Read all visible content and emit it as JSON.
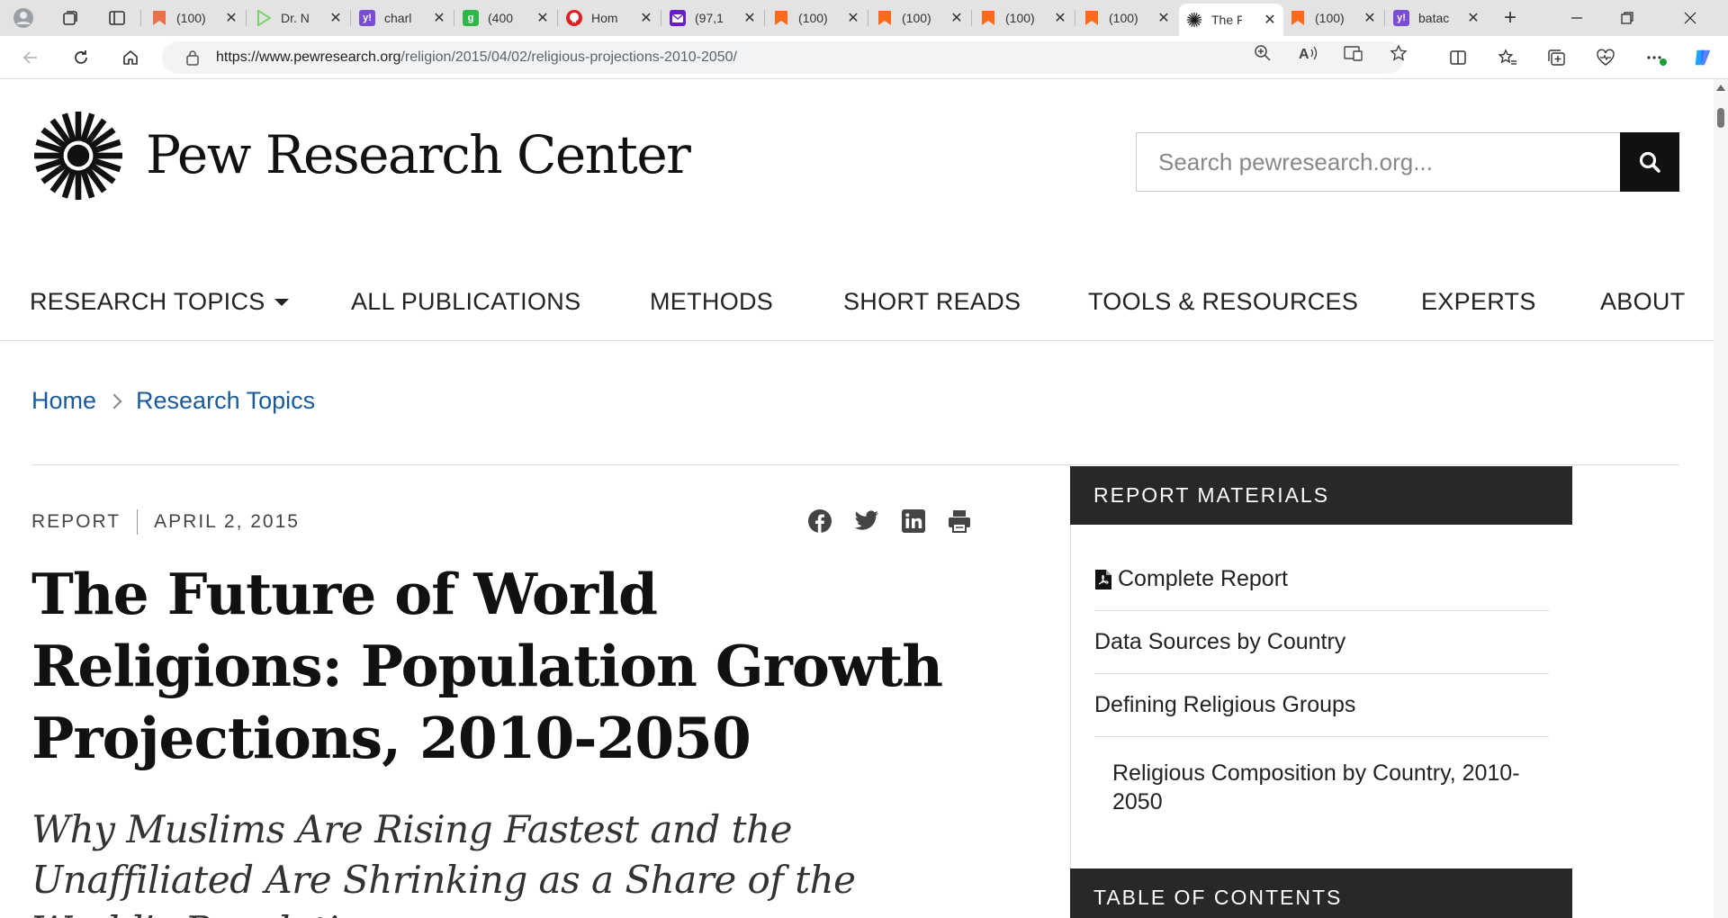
{
  "browser": {
    "tabs": [
      {
        "title": "(100)",
        "favicon_color": "#e8734a",
        "favicon_glyph": "bookmark-icon"
      },
      {
        "title": "Dr. N",
        "favicon_color": "#7bd36b",
        "favicon_glyph": "play-icon"
      },
      {
        "title": "charl",
        "favicon_color": "#7b4dd6",
        "favicon_glyph": "y!"
      },
      {
        "title": "(400",
        "favicon_color": "#2fb84a",
        "favicon_glyph": "g"
      },
      {
        "title": "Hom",
        "favicon_color": "#e02020",
        "favicon_glyph": "pin-icon"
      },
      {
        "title": "(97,1",
        "favicon_color": "#6a1bd1",
        "favicon_glyph": "mail-icon"
      },
      {
        "title": "(100)",
        "favicon_color": "#ff6a1a",
        "favicon_glyph": "bookmark-icon"
      },
      {
        "title": "(100)",
        "favicon_color": "#ff6a1a",
        "favicon_glyph": "bookmark-icon"
      },
      {
        "title": "(100)",
        "favicon_color": "#ff6a1a",
        "favicon_glyph": "bookmark-icon"
      },
      {
        "title": "(100)",
        "favicon_color": "#ff6a1a",
        "favicon_glyph": "bookmark-icon"
      },
      {
        "title": "The F",
        "favicon_color": "#111111",
        "favicon_glyph": "pew-icon",
        "active": true
      },
      {
        "title": "(100)",
        "favicon_color": "#ff6a1a",
        "favicon_glyph": "bookmark-icon"
      },
      {
        "title": "batac",
        "favicon_color": "#7b4dd6",
        "favicon_glyph": "y!"
      }
    ],
    "close_glyph": "✕",
    "new_tab_glyph": "+",
    "url_prefix": "https://www.pewresearch.org",
    "url_path": "/religion/2015/04/02/religious-projections-2010-2050/"
  },
  "site": {
    "brand": "Pew Research Center",
    "search_placeholder": "Search pewresearch.org...",
    "nav": {
      "research_topics": "RESEARCH TOPICS",
      "all_publications": "ALL PUBLICATIONS",
      "methods": "METHODS",
      "short_reads": "SHORT READS",
      "tools_resources": "TOOLS & RESOURCES",
      "experts": "EXPERTS",
      "about": "ABOUT"
    },
    "breadcrumb": {
      "home": "Home",
      "research_topics": "Research Topics"
    }
  },
  "article": {
    "type": "REPORT",
    "date": "APRIL 2, 2015",
    "title": "The Future of World Religions: Population Growth Projections, 2010-2050",
    "subtitle": "Why Muslims Are Rising Fastest and the Unaffiliated Are Shrinking as a Share of the World’s Population"
  },
  "sidebar": {
    "header": "REPORT MATERIALS",
    "links": [
      "Complete Report",
      "Data Sources by Country",
      "Defining Religious Groups",
      "Religious Composition by Country, 2010-2050"
    ],
    "toc_header": "TABLE OF CONTENTS"
  }
}
